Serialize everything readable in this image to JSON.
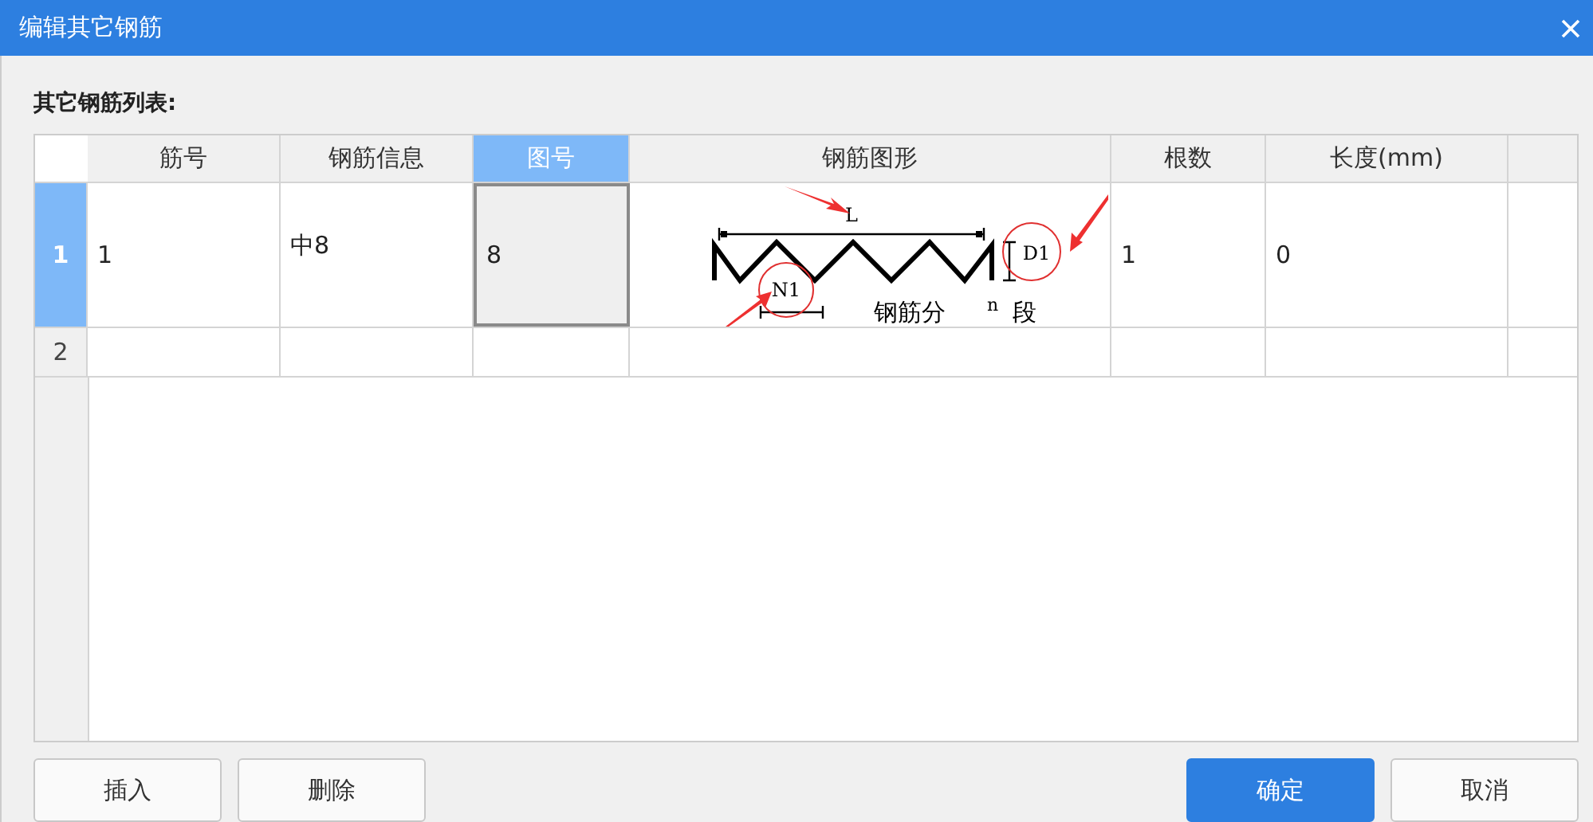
{
  "window": {
    "title": "编辑其它钢筋"
  },
  "list_label": "其它钢筋列表:",
  "table": {
    "columns": [
      {
        "label": "筋号",
        "selected": false
      },
      {
        "label": "钢筋信息",
        "selected": false
      },
      {
        "label": "图号",
        "selected": true
      },
      {
        "label": "钢筋图形",
        "selected": false
      },
      {
        "label": "根数",
        "selected": false
      },
      {
        "label": "长度(mm)",
        "selected": false
      }
    ],
    "rows": [
      {
        "header": "1",
        "selected": true,
        "cells": [
          {
            "kind": "text",
            "text": "1",
            "focused": false
          },
          {
            "kind": "text",
            "text": "中8",
            "focused": false
          },
          {
            "kind": "text",
            "text": "8",
            "focused": true
          },
          {
            "kind": "figure",
            "labels": {
              "length": "L",
              "offset": "D1",
              "segment": "N1",
              "caption": "钢筋分",
              "n": "n",
              "unit": "段"
            },
            "focused": false
          },
          {
            "kind": "text",
            "text": "1",
            "focused": false
          },
          {
            "kind": "text",
            "text": "0",
            "focused": false
          }
        ]
      },
      {
        "header": "2",
        "selected": false
      }
    ]
  },
  "buttons": [
    {
      "label": "插入",
      "primary": false
    },
    {
      "label": "删除",
      "primary": false
    },
    {
      "label": "确定",
      "primary": true
    },
    {
      "label": "取消",
      "primary": false
    }
  ]
}
